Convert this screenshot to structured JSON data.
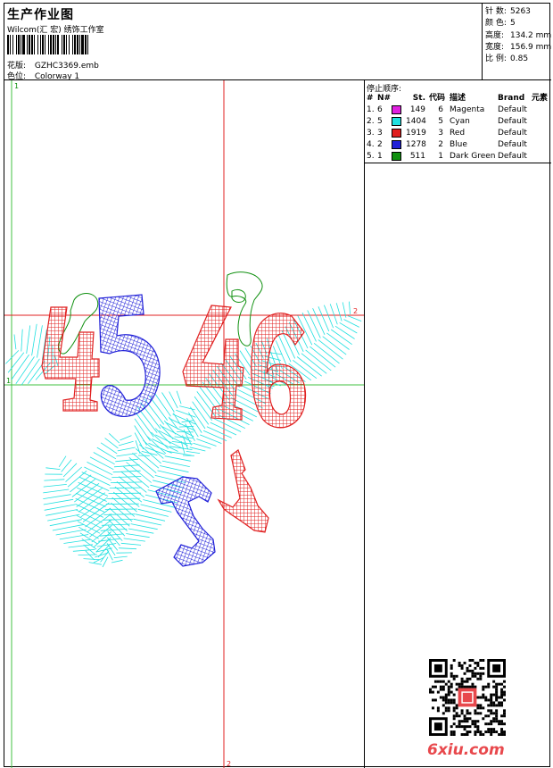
{
  "header": {
    "title": "生产作业图",
    "company": "Wilcom(汇 宏) 绣饰工作室",
    "design_label": "花版:",
    "design_value": "GZHC3369.emb",
    "colorway_label": "色位:",
    "colorway_value": "Colorway 1"
  },
  "stats": [
    {
      "label": "针 数:",
      "value": "5263"
    },
    {
      "label": "颜 色:",
      "value": "5"
    },
    {
      "label": "高度:",
      "value": "134.2 mm"
    },
    {
      "label": "宽度:",
      "value": "156.9 mm"
    },
    {
      "label": "比 例:",
      "value": "0.85"
    }
  ],
  "stop_sequence": {
    "title": "停止顺序:",
    "headers": {
      "num": "#",
      "n": "N#",
      "st": "St.",
      "code": "代码",
      "desc": "描述",
      "brand": "Brand",
      "elem": "元素"
    },
    "rows": [
      {
        "num": "1.",
        "n": "6",
        "color": "#e020e0",
        "st": "149",
        "code": "6",
        "desc": "Magenta",
        "brand": "Default"
      },
      {
        "num": "2.",
        "n": "5",
        "color": "#20e0e0",
        "st": "1404",
        "code": "5",
        "desc": "Cyan",
        "brand": "Default"
      },
      {
        "num": "3.",
        "n": "3",
        "color": "#e02020",
        "st": "1919",
        "code": "3",
        "desc": "Red",
        "brand": "Default"
      },
      {
        "num": "4.",
        "n": "2",
        "color": "#2020d8",
        "st": "1278",
        "code": "2",
        "desc": "Blue",
        "brand": "Default"
      },
      {
        "num": "5.",
        "n": "1",
        "color": "#109010",
        "st": "511",
        "code": "1",
        "desc": "Dark Green",
        "brand": "Default"
      }
    ]
  },
  "design": {
    "guide_labels": {
      "top_left": "1",
      "left": "1",
      "right": "2",
      "bottom": "2"
    },
    "colors": {
      "red": "#e02020",
      "blue": "#2020d8",
      "cyan": "#20e0e0",
      "green": "#109010",
      "guide_red": "#e02020",
      "guide_green": "#40c040"
    }
  },
  "footer": {
    "site": "6xiu.com"
  }
}
